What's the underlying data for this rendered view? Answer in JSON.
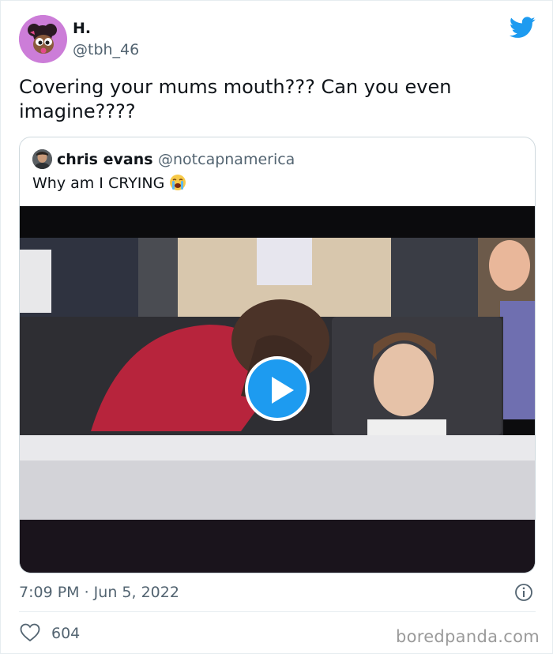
{
  "tweet": {
    "author": {
      "display_name": "H.",
      "handle": "@tbh_46"
    },
    "text": "Covering your mums mouth??? Can you even imagine????",
    "quoted_tweet": {
      "author": {
        "display_name": "chris evans",
        "handle": "@notcapnamerica"
      },
      "text": "Why am I CRYING",
      "emoji_icon": "crying-face-emoji",
      "media": {
        "type": "video",
        "play_icon": "play-icon"
      }
    },
    "timestamp": "7:09 PM · Jun 5, 2022",
    "likes": "604"
  },
  "watermark": "boredpanda.com",
  "colors": {
    "accent": "#1d9bf0",
    "secondary_text": "#536471",
    "avatar_bg": "#cc7dd8"
  },
  "icons": [
    "twitter-bird-icon",
    "info-icon",
    "heart-icon",
    "play-icon"
  ]
}
